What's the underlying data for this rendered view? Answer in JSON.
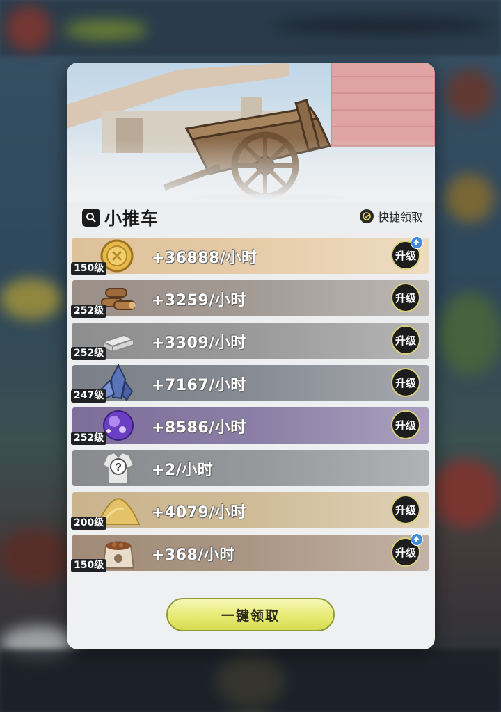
{
  "panel": {
    "title": "小推车",
    "quick_claim_label": "快捷领取",
    "claim_all_label": "一键领取",
    "upgrade_label": "升级"
  },
  "resources": [
    {
      "icon": "gold-coin-icon",
      "level": "150级",
      "rate": "+36888/小时",
      "upgradable": true,
      "upgrade_alert": true
    },
    {
      "icon": "wood-logs-icon",
      "level": "252级",
      "rate": "+3259/小时",
      "upgradable": true,
      "upgrade_alert": false
    },
    {
      "icon": "stone-bricks-icon",
      "level": "252级",
      "rate": "+3309/小时",
      "upgradable": true,
      "upgrade_alert": false
    },
    {
      "icon": "crystal-ore-icon",
      "level": "247级",
      "rate": "+7167/小时",
      "upgradable": true,
      "upgrade_alert": false
    },
    {
      "icon": "purple-orb-icon",
      "level": "252级",
      "rate": "+8586/小时",
      "upgradable": true,
      "upgrade_alert": false
    },
    {
      "icon": "mystery-armor-icon",
      "level": "",
      "rate": "+2/小时",
      "upgradable": false,
      "upgrade_alert": false
    },
    {
      "icon": "sand-pile-icon",
      "level": "200级",
      "rate": "+4079/小时",
      "upgradable": true,
      "upgrade_alert": false
    },
    {
      "icon": "grain-sack-icon",
      "level": "150级",
      "rate": "+368/小时",
      "upgradable": true,
      "upgrade_alert": true
    }
  ],
  "colors": {
    "claim_button": "#e7ea72",
    "upgrade_ring": "#d9d17a",
    "alert_badge": "#3d8be0"
  }
}
